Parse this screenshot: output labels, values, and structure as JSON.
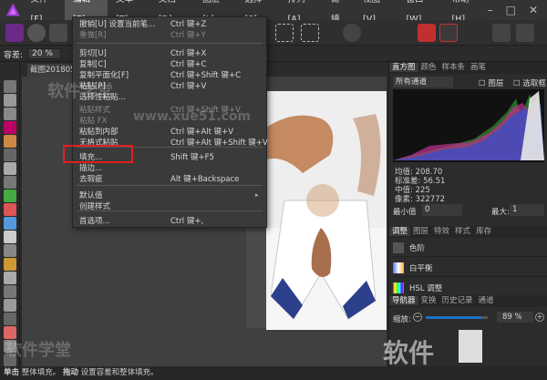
{
  "menubar": {
    "items": [
      "文件[F]",
      "编辑[E]",
      "文本[T]",
      "文档[D]",
      "图层[L]",
      "选择[S]",
      "排列[A]",
      "滤镜",
      "视图[V]",
      "窗口[W]",
      "帮助[H]"
    ],
    "window_controls": [
      "–",
      "□",
      "✕"
    ]
  },
  "context": {
    "tolerance_label": "容差:",
    "tolerance_value": "20 %"
  },
  "document": {
    "tab_label": "截图201805"
  },
  "edit_menu": {
    "items": [
      {
        "label": "撤销[U] 设置当前笔...",
        "shortcut": "Ctrl 键+Z",
        "disabled": false
      },
      {
        "label": "重做[R]",
        "shortcut": "Ctrl 键+Y",
        "disabled": true
      },
      {
        "label": "剪切[U]",
        "shortcut": "Ctrl 键+X",
        "disabled": false
      },
      {
        "label": "复制[C]",
        "shortcut": "Ctrl 键+C",
        "disabled": false
      },
      {
        "label": "复制平面化[F]",
        "shortcut": "Ctrl 键+Shift 键+C",
        "disabled": false
      },
      {
        "label": "粘贴[P]",
        "shortcut": "Ctrl 键+V",
        "disabled": false
      },
      {
        "label": "选择性粘贴...",
        "shortcut": "",
        "disabled": false
      },
      {
        "label": "粘贴样式",
        "shortcut": "Ctrl 键+Shift 键+V",
        "disabled": true
      },
      {
        "label": "粘贴 FX",
        "shortcut": "",
        "disabled": true
      },
      {
        "label": "粘贴到内部",
        "shortcut": "Ctrl 键+Alt 键+V",
        "disabled": false
      },
      {
        "label": "无格式粘贴",
        "shortcut": "Ctrl 键+Alt 键+Shift 键+V",
        "disabled": false
      },
      {
        "label": "填充...",
        "shortcut": "Shift 键+F5",
        "disabled": false
      },
      {
        "label": "描边...",
        "shortcut": "",
        "disabled": false
      },
      {
        "label": "去瑕疵",
        "shortcut": "Alt 键+Backspace",
        "disabled": false
      },
      {
        "label": "默认值",
        "shortcut": "",
        "disabled": false
      },
      {
        "label": "创建样式",
        "shortcut": "",
        "disabled": false
      },
      {
        "label": "首选项...",
        "shortcut": "Ctrl 键+,",
        "disabled": false
      }
    ]
  },
  "right_panel": {
    "top_tabs": [
      "直方图",
      "颜色",
      "样本条",
      "画笔"
    ],
    "channel": "所有通道",
    "layer_label": "图层",
    "marquee_label": "选取框",
    "stats": {
      "mean_label": "均值:",
      "mean": "208.70",
      "std_label": "标准差:",
      "std": "56.51",
      "median_label": "中值:",
      "median": "225",
      "pixels_label": "像素:",
      "pixels": "322772"
    },
    "min_label": "最小值",
    "min": "0",
    "max_label": "最大:",
    "max": "1",
    "adj_tabs": [
      "调整",
      "图层",
      "特效",
      "样式",
      "库存"
    ],
    "adjustments": [
      "色阶",
      "白平衡",
      "HSL 调整"
    ],
    "nav_tabs": [
      "导航器",
      "变换",
      "历史记录",
      "通道"
    ],
    "zoom_label": "缩放:",
    "zoom": "89 %",
    "zoom_fraction": 0.89
  },
  "status": {
    "prefix": "单击",
    "text1": "整体填充。",
    "mode": "拖动",
    "text2": "设置容差和整体填充。"
  },
  "watermark": {
    "text1": "软件学堂",
    "url": "www.xue51.com",
    "brand": "软件"
  },
  "colors": {
    "menubar": "#333333",
    "dropdown": "#3a3a3a",
    "highlight": "#e02020",
    "accent": "#1a72c4"
  }
}
